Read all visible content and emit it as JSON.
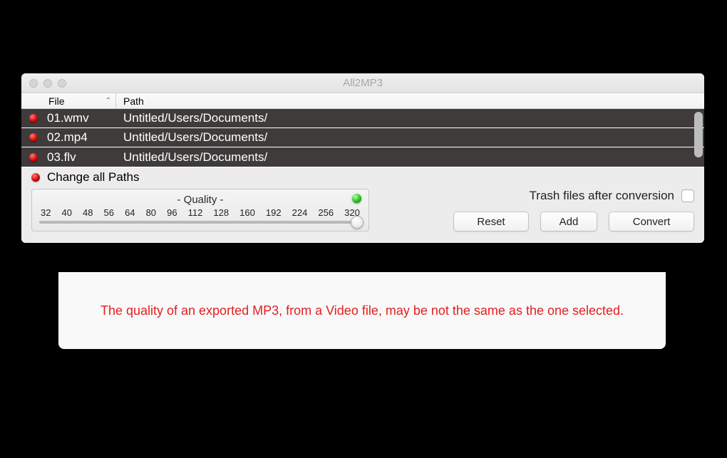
{
  "window": {
    "title": "All2MP3"
  },
  "columns": {
    "file": "File",
    "path": "Path"
  },
  "rows": [
    {
      "file": "01.wmv",
      "path": "Untitled/Users/Documents/"
    },
    {
      "file": "02.mp4",
      "path": "Untitled/Users/Documents/"
    },
    {
      "file": "03.flv",
      "path": "Untitled/Users/Documents/"
    }
  ],
  "change_paths": "Change all Paths",
  "quality": {
    "title": "- Quality -",
    "ticks": [
      "32",
      "40",
      "48",
      "56",
      "64",
      "80",
      "96",
      "112",
      "128",
      "160",
      "192",
      "224",
      "256",
      "320"
    ]
  },
  "trash_label": "Trash files after conversion",
  "buttons": {
    "reset": "Reset",
    "add": "Add",
    "convert": "Convert"
  },
  "warning": "The quality of an exported MP3, from a Video file, may be not the same as the one selected."
}
